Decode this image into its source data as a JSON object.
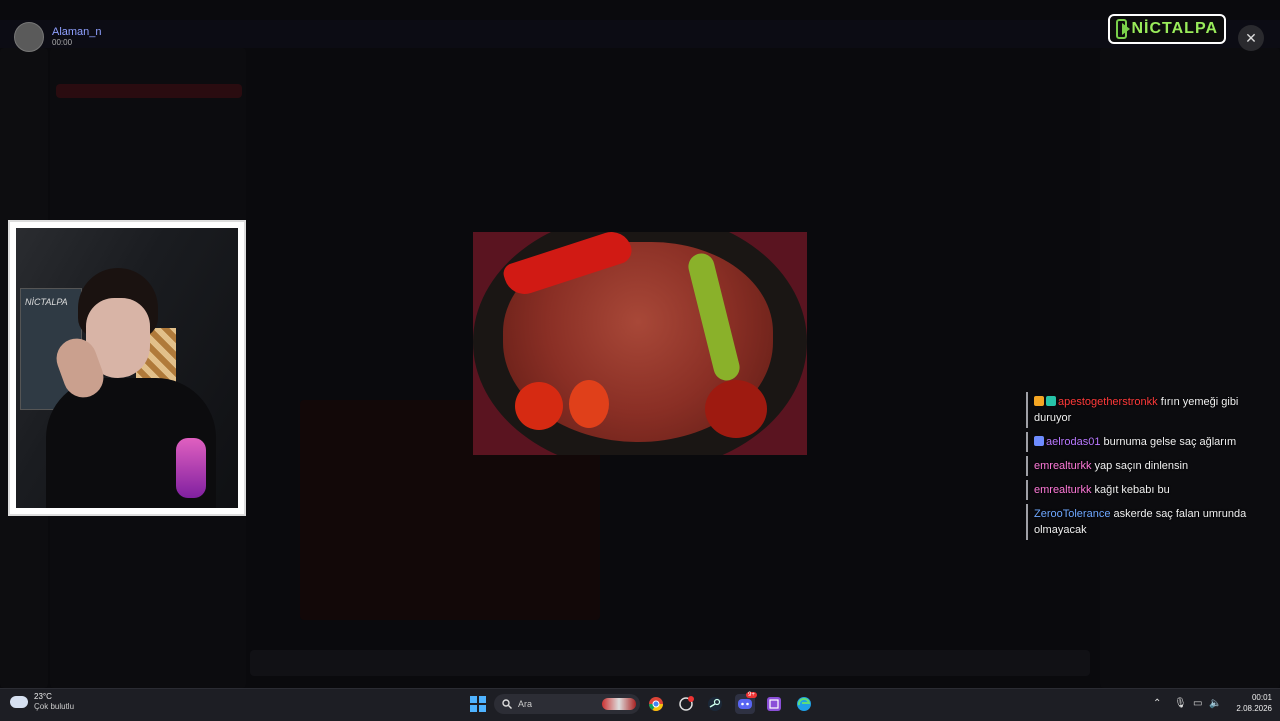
{
  "viewer": {
    "name": "Alaman_n",
    "time": "00:00"
  },
  "logo": {
    "text": "NİCTALPA"
  },
  "webcam": {
    "poster_text": "NİCTALPA"
  },
  "chat": [
    {
      "user": "apestogetherstronkk",
      "color": "#ff3a3a",
      "text": "fırın yemeği gibi duruyor",
      "badges": [
        "#f5a623",
        "#27c3a8"
      ]
    },
    {
      "user": "aelrodas01",
      "color": "#b979ff",
      "text": "burnuma gelse saç ağlarım",
      "badges": [
        "#6e8cff"
      ]
    },
    {
      "user": "emrealturkk",
      "color": "#ff7ad9",
      "text": "yap saçın dinlensin",
      "badges": []
    },
    {
      "user": "emrealturkk",
      "color": "#ff7ad9",
      "text": "kağıt kebabı bu",
      "badges": []
    },
    {
      "user": "ZerooTolerance",
      "color": "#6fa8ff",
      "text": "askerde saç falan umrunda olmayacak",
      "badges": []
    }
  ],
  "taskbar": {
    "temperature": "23°C",
    "condition": "Çok bulutlu",
    "search_label": "Ara",
    "time": "00:01",
    "date": "2.08.2026",
    "discord_badge": "9+"
  },
  "icons": [
    "search-icon",
    "windows-icon",
    "chrome-icon",
    "steam-icon",
    "discord-icon",
    "edge-icon",
    "close-icon",
    "cloud-icon",
    "wifi-icon",
    "speaker-icon",
    "mic-icon",
    "chevron-up-icon"
  ]
}
